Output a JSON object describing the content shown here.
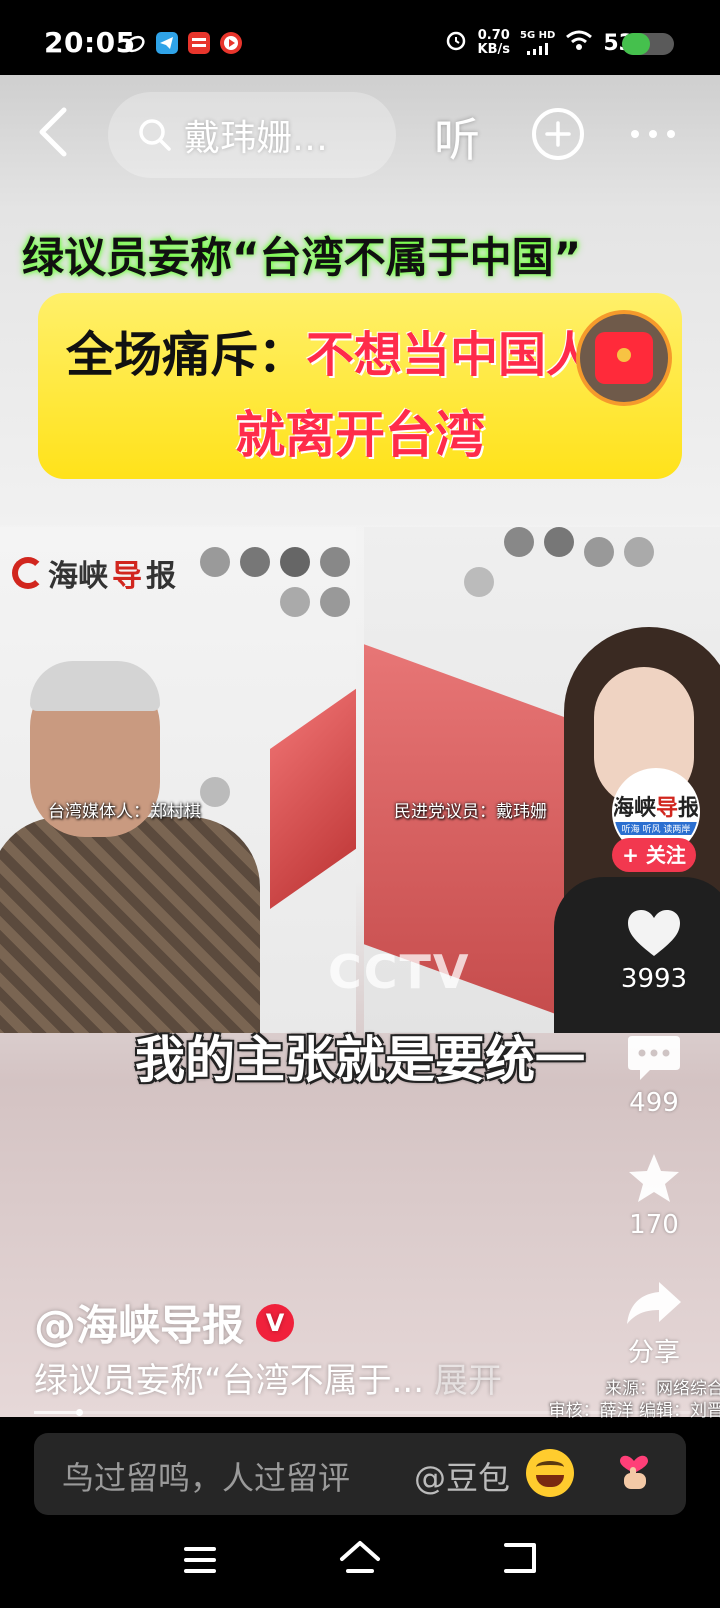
{
  "status_bar": {
    "time": "20:05",
    "app_icons": [
      "weibo-icon",
      "telegram-icon",
      "toutiao-icon",
      "video-app-icon"
    ],
    "app_icon_colors": [
      "#ffffff",
      "#2fa3e8",
      "#e8352c",
      "#e8352c"
    ],
    "net_speed": "0.70",
    "net_unit": "KB/s",
    "signal": "5G HD",
    "battery": "53%",
    "battery_level": 0.53
  },
  "top_nav": {
    "search_text": "戴玮姗…",
    "listen_label": "听"
  },
  "video": {
    "headline": "绿议员妄称“台湾不属于中国”",
    "box_line1_black": "全场痛斥：",
    "box_line1_red": "不想当中国人",
    "box_line2": "就离开台湾",
    "logo_prefix": "海峡",
    "logo_red": "导",
    "logo_suffix": "报",
    "caption_left": "台湾媒体人：郑村棋",
    "caption_right": "民进党议员：戴玮姗",
    "watermark": "CCTV",
    "subtitle": "我的主张就是要统一"
  },
  "rail": {
    "avatar_top": "海峡",
    "avatar_red": "导",
    "avatar_end": "报",
    "avatar_sub": "听海 听风 读两岸",
    "follow_label": "+ 关注",
    "likes": "3993",
    "comments": "499",
    "favorites": "170",
    "share_label": "分享"
  },
  "post": {
    "author": "@海峡导报",
    "verified_mark": "V",
    "description": "绿议员妄称“台湾不属于...",
    "expand_label": "展开",
    "credits_line1": "来源：网络综合",
    "credits_line2": "审核：薛洋 编辑：刘晋",
    "progress": 0.07
  },
  "comment_bar": {
    "placeholder": "鸟过留鸣，人过留评",
    "mention": "@豆包"
  },
  "colors": {
    "accent_red": "#f2384f",
    "highlight_yellow": "#ffe21a",
    "glow_green": "#6cff3a"
  }
}
